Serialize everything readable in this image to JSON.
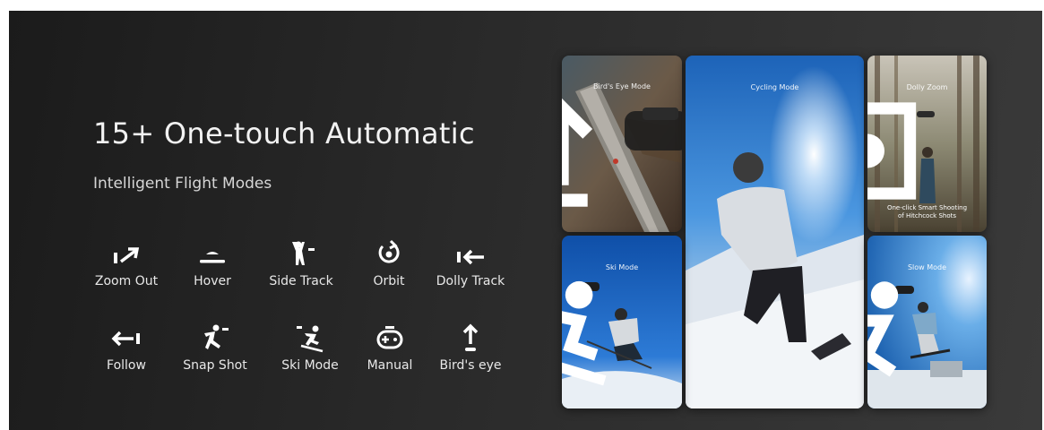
{
  "headline": "15+ One-touch Automatic",
  "subheadline": "Intelligent Flight Modes",
  "modes": [
    {
      "label": "Zoom Out",
      "icon": "zoom-out-icon"
    },
    {
      "label": "Hover",
      "icon": "hover-icon"
    },
    {
      "label": "Side Track",
      "icon": "side-track-icon"
    },
    {
      "label": "Orbit",
      "icon": "orbit-icon"
    },
    {
      "label": "Dolly Track",
      "icon": "dolly-track-icon"
    },
    {
      "label": "Follow",
      "icon": "follow-icon"
    },
    {
      "label": "Snap Shot",
      "icon": "snap-shot-icon"
    },
    {
      "label": "Ski Mode",
      "icon": "ski-mode-icon"
    },
    {
      "label": "Manual",
      "icon": "gamepad-icon"
    },
    {
      "label": "Bird's eye",
      "icon": "birds-eye-icon"
    }
  ],
  "tiles": [
    {
      "title": "Bird's Eye Mode",
      "icon": "up-arrow-icon"
    },
    {
      "title": "Cycling Mode"
    },
    {
      "title": "Dolly Zoom",
      "icon": "focus-icon",
      "caption_line1": "One-click Smart Shooting",
      "caption_line2": "of Hitchcock Shots"
    },
    {
      "title": "Ski Mode",
      "icon": "skier-icon"
    },
    {
      "title": "Slow Mode",
      "icon": "runner-icon"
    }
  ],
  "colors": {
    "background": "#222222",
    "text": "#f2f2f2",
    "sky_blue": "#2f7fd6"
  }
}
